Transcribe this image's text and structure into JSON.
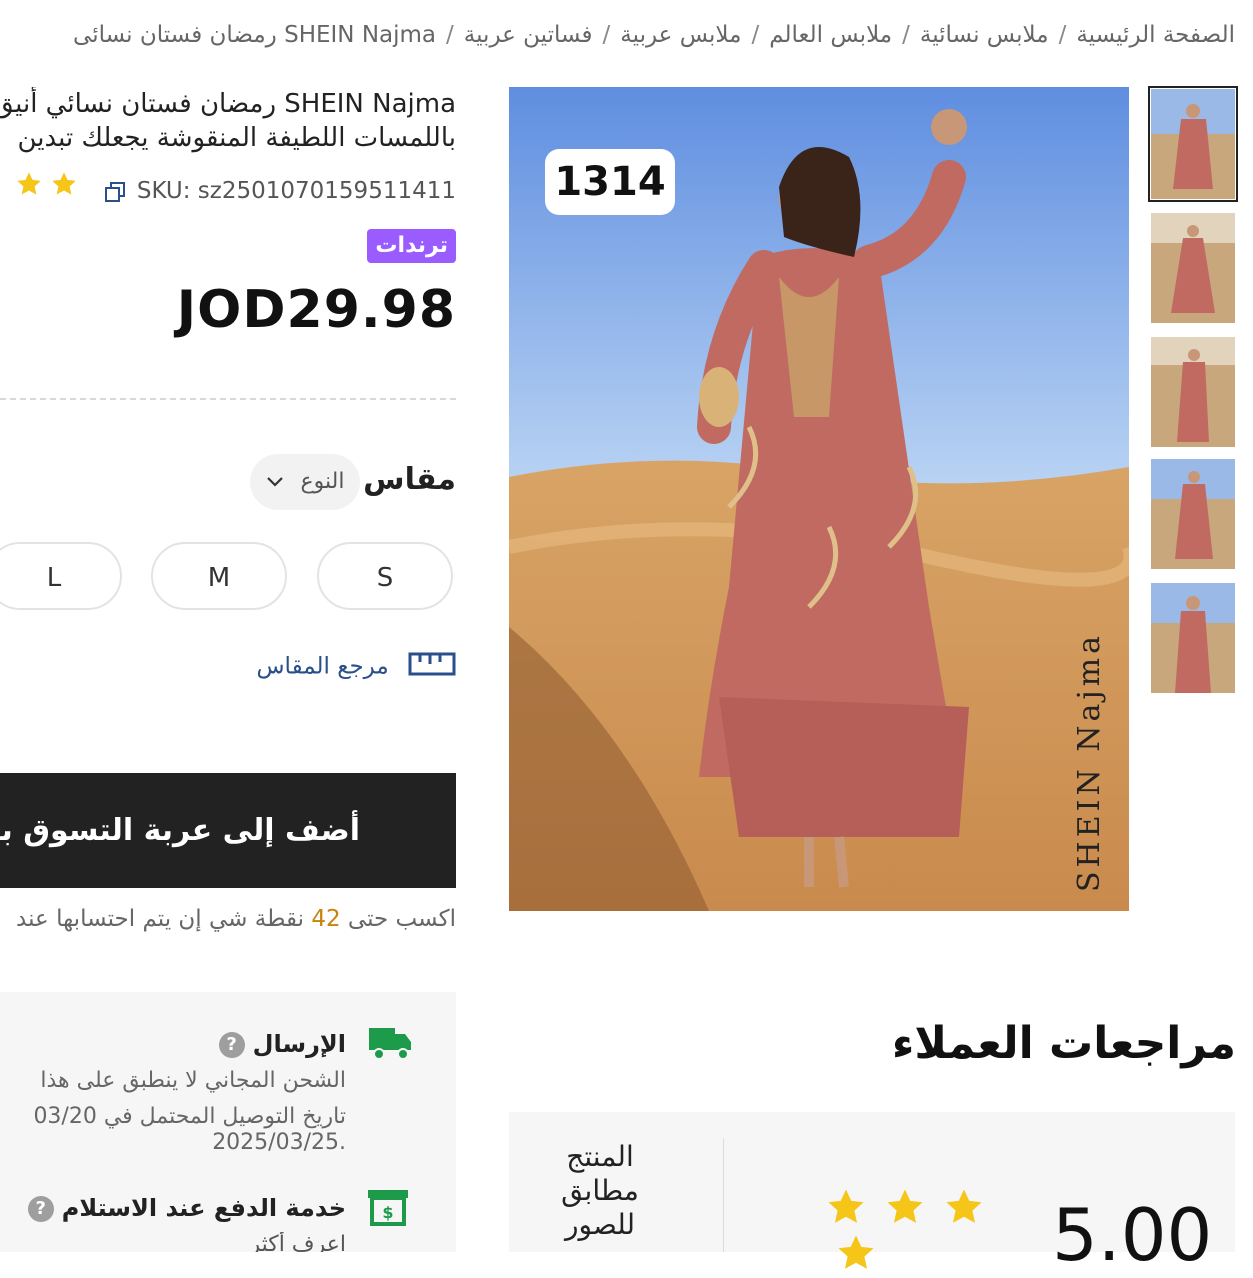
{
  "breadcrumb": {
    "items": [
      "الصفحة الرئيسية",
      "ملابس نسائية",
      "ملابس العالم",
      "ملابس عربية",
      "فساتين عربية",
      "SHEIN Najma رمضان فستان نسائى"
    ],
    "separator": "/"
  },
  "gallery": {
    "photo_count": "1314",
    "brand_watermark": "SHEIN Najma",
    "thumbnail_count": 5
  },
  "product": {
    "title_line1": "SHEIN Najma رمضان فستان نسائي أنيق",
    "title_line2": "باللمسات اللطيفة المنقوشة يجعلك تبدين",
    "sku": "SKU: sz2501070159511411",
    "badge": "ترندات",
    "price": "JOD29.98",
    "rating_stars_visible": 2
  },
  "size": {
    "label": "مقاس",
    "type_select": "النوع",
    "options": [
      "S",
      "M",
      "L"
    ],
    "guide": "مرجع المقاس"
  },
  "cart": {
    "add_button": "أضف إلى عربة التسوق بنجاح"
  },
  "points": {
    "prefix": "اكسب حتى",
    "value": "42",
    "suffix": "نقطة شي إن يتم احتسابها عند"
  },
  "shipping": {
    "title": "الإرسال",
    "line1": "الشحن المجاني لا ينطبق على هذا",
    "line2": "تاريخ التوصيل المحتمل في 03/20",
    "line3": ".2025/03/25",
    "cod_title": "خدمة الدفع عند الاستلام",
    "cod_link": "اعرف أكثر"
  },
  "reviews": {
    "heading": "مراجعات العملاء",
    "rating": "5.00",
    "fit_label": "المنتج مطابق للصور",
    "stars": 4
  },
  "colors": {
    "accent_purple": "#9b5cff",
    "star_yellow": "#f5c518",
    "icon_green": "#1e9b4a",
    "link_blue": "#2a4f8a",
    "points_orange": "#c9820e"
  }
}
